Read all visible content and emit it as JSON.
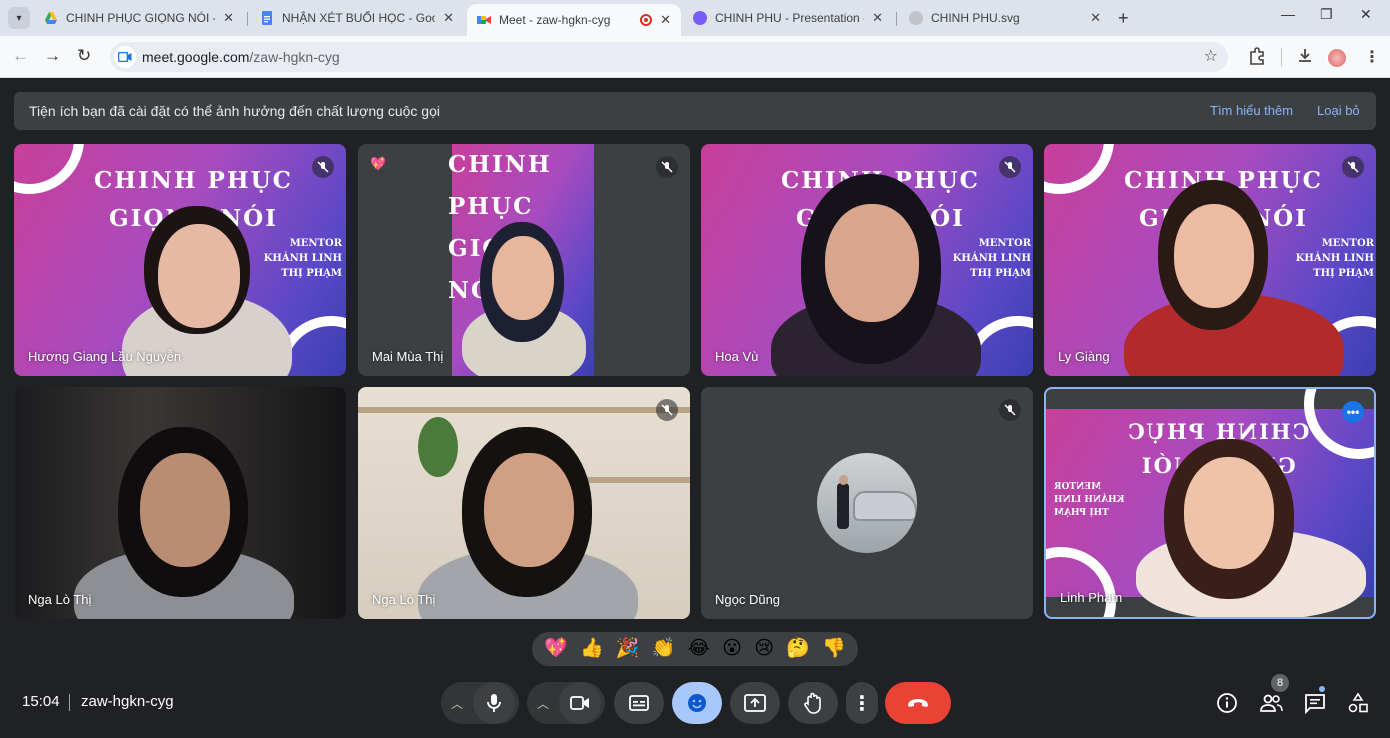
{
  "browser": {
    "tabs": [
      {
        "title": "CHINH PHỤC GIỌNG NÓI - Goo",
        "favicon_color": "#34a853"
      },
      {
        "title": "NHẬN XÉT BUỔI HỌC - Google",
        "favicon_color": "#4285f4"
      },
      {
        "title": "Meet - zaw-hgkn-cyg",
        "favicon_color": "#00897b"
      },
      {
        "title": "CHINH PHU - Presentation - Ca",
        "favicon_color": "#7b5cff"
      },
      {
        "title": "CHINH PHU.svg",
        "favicon_color": "#9aa0a6"
      }
    ],
    "url_host": "meet.google.com",
    "url_path": "/zaw-hgkn-cyg"
  },
  "notice": {
    "text": "Tiện ích bạn đã cài đặt có thể ảnh hưởng đến chất lượng cuộc gọi",
    "learn_more": "Tìm hiểu thêm",
    "dismiss": "Loại bỏ"
  },
  "banner": {
    "line1": "CHINH PHỤC",
    "line2": "GIỌNG NÓI",
    "mentor1": "MENTOR",
    "mentor2": "KHÁNH LINH",
    "mentor3": "THỊ PHẠM"
  },
  "participants": [
    {
      "name": "Hương Giang Lầu Nguyễn"
    },
    {
      "name": "Mai Mùa Thị"
    },
    {
      "name": "Hoa Vù"
    },
    {
      "name": "Ly Giàng"
    },
    {
      "name": "Nga Lò Thị"
    },
    {
      "name": "Nga Lò Thị"
    },
    {
      "name": "Ngọc Dũng"
    },
    {
      "name": "Linh Phạm"
    }
  ],
  "reactions": [
    "💖",
    "👍",
    "🎉",
    "👏",
    "😂",
    "😮",
    "😢",
    "🤔",
    "👎"
  ],
  "footer": {
    "time": "15:04",
    "meeting_code": "zaw-hgkn-cyg",
    "participant_count": "8"
  }
}
